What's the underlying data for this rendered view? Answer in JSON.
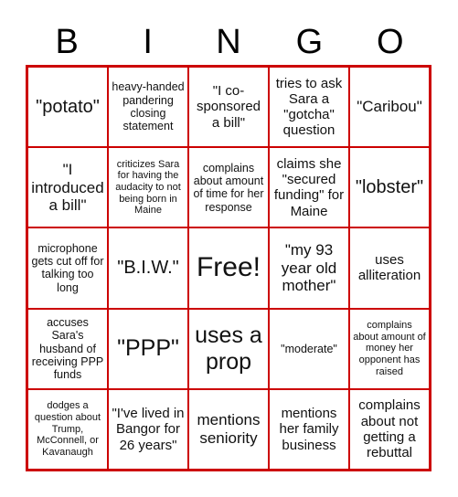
{
  "header": {
    "letters": [
      "B",
      "I",
      "N",
      "G",
      "O"
    ]
  },
  "board": {
    "accent_color": "#cc0000",
    "cells": [
      [
        "\"potato\"",
        "heavy-handed pandering closing statement",
        "\"I co-sponsored a bill\"",
        "tries to ask Sara a \"gotcha\" question",
        "\"Caribou\""
      ],
      [
        "\"I introduced a bill\"",
        "criticizes Sara for having the audacity to not being born in Maine",
        "complains about amount of time for her response",
        "claims she \"secured funding\" for Maine",
        "\"lobster\""
      ],
      [
        "microphone gets cut off for talking too long",
        "\"B.I.W.\"",
        "Free!",
        "\"my 93 year old mother\"",
        "uses alliteration"
      ],
      [
        "accuses Sara's husband of receiving PPP funds",
        "\"PPP\"",
        "uses a prop",
        "\"moderate\"",
        "complains about amount of money her opponent has raised"
      ],
      [
        "dodges a question about Trump, McConnell, or Kavanaugh",
        "\"I've lived in Bangor for 26 years\"",
        "mentions seniority",
        "mentions her family business",
        "complains about not getting a rebuttal"
      ]
    ]
  }
}
